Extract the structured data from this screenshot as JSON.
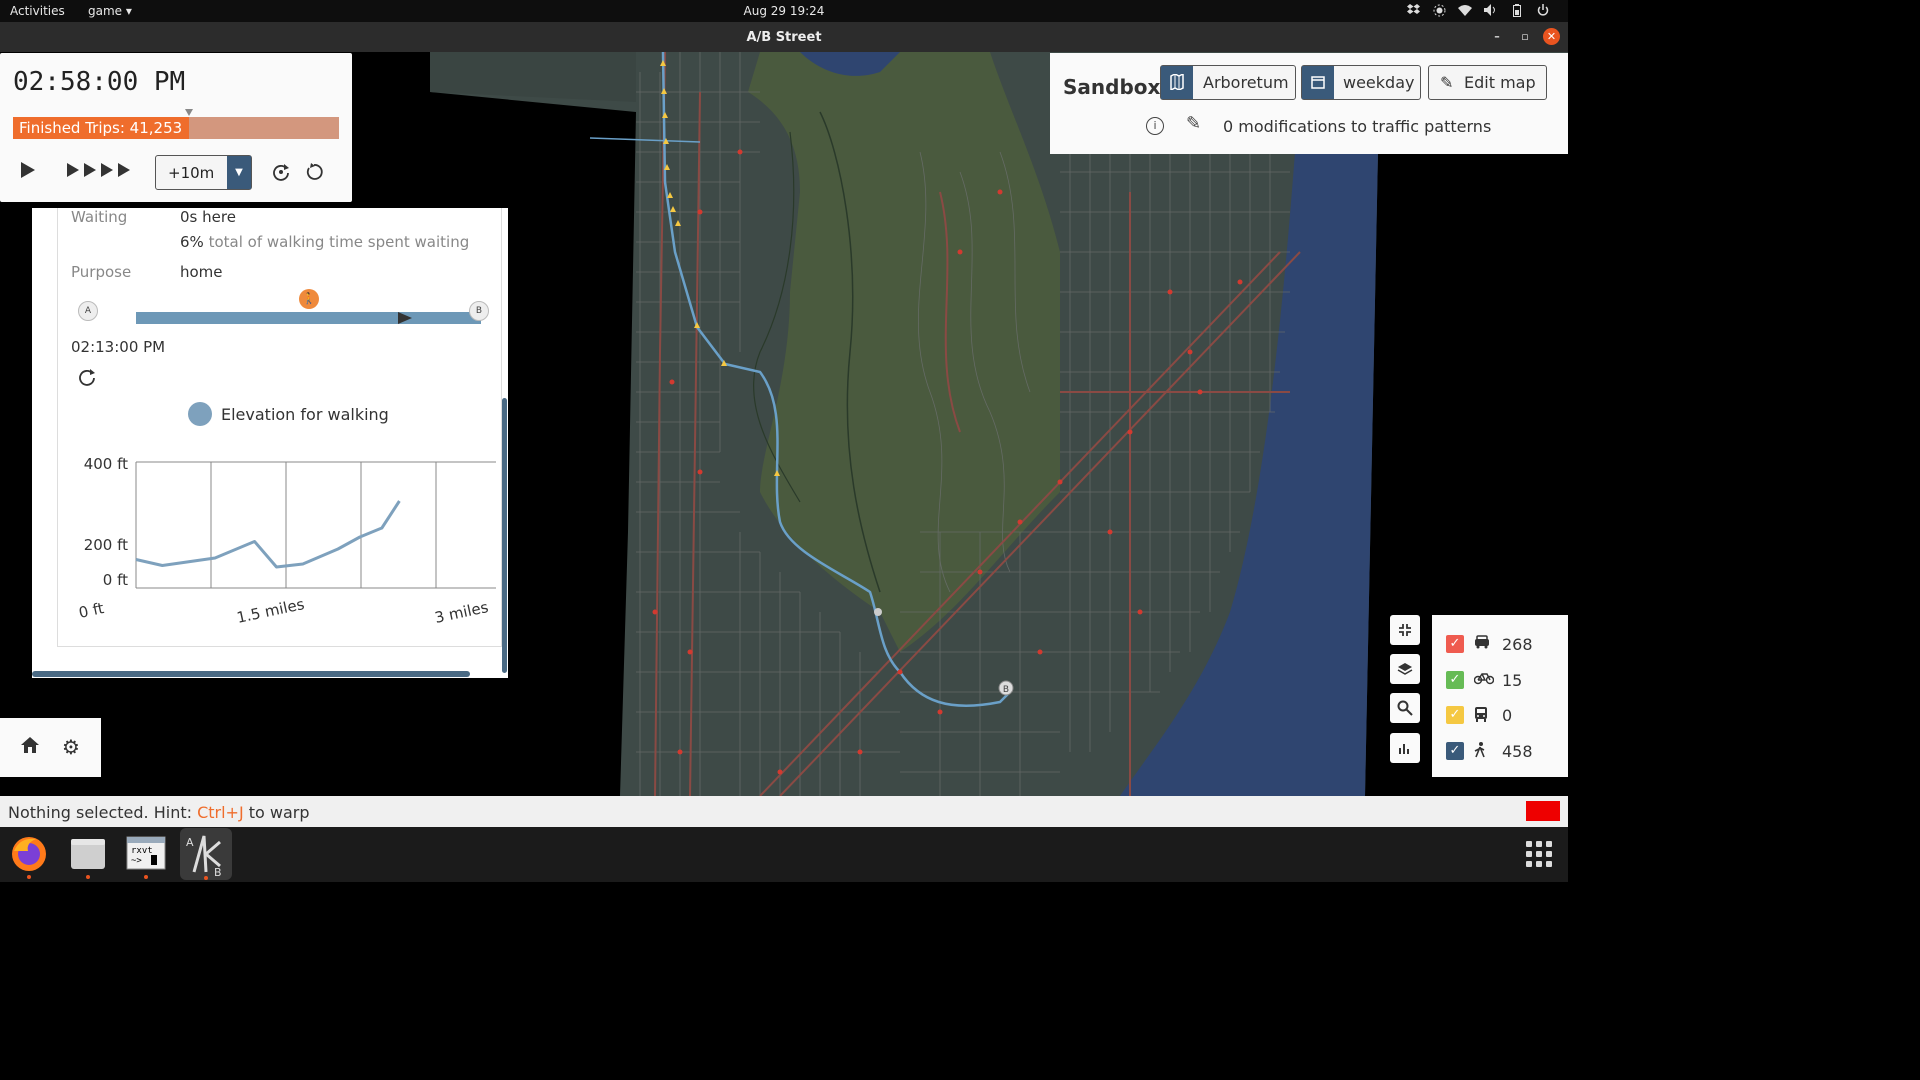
{
  "topbar": {
    "activities": "Activities",
    "app_menu": "game ▾",
    "clock": "Aug 29  19:24"
  },
  "window": {
    "title": "A/B Street"
  },
  "time_panel": {
    "time": "02:58:00 PM",
    "finished_trips": "Finished Trips: 41,253",
    "finished_trips_fraction": 0.54,
    "play_icon": "play-icon",
    "fast_forward_icon": "fast-forward-icon",
    "jump_value": "+10m"
  },
  "trip_info": {
    "waiting_key": "Waiting",
    "waiting_value": "0s here",
    "waiting_pct": "6%",
    "waiting_pct_text": "total of walking time spent waiting",
    "purpose_key": "Purpose",
    "purpose_value": "home",
    "start_label": "A",
    "end_label": "B",
    "trip_progress": 0.8,
    "start_time": "02:13:00 PM",
    "chart_legend": "Elevation for walking"
  },
  "chart_data": {
    "type": "line",
    "title": "",
    "xlabel": "",
    "ylabel": "",
    "series": [
      {
        "name": "Elevation for walking",
        "x": [
          0,
          0.3,
          0.9,
          1.35,
          1.6,
          1.9,
          2.3,
          2.55,
          2.8,
          3.0
        ],
        "values": [
          95,
          75,
          100,
          155,
          70,
          80,
          130,
          170,
          200,
          290
        ]
      }
    ],
    "x_range": [
      0,
      4.1
    ],
    "y_range": [
      0,
      420
    ],
    "x_tick_labels": [
      "0 ft",
      "1.5 miles",
      "3 miles"
    ],
    "y_tick_labels": [
      "400 ft",
      "200 ft",
      "0 ft"
    ],
    "x_gridline_count": 5,
    "grid": true
  },
  "sandbox": {
    "title": "Sandbox",
    "map_name": "Arboretum",
    "scenario": "weekday",
    "edit_map": "Edit map",
    "modifications": "0 modifications to traffic patterns"
  },
  "agents": [
    {
      "icon": "car-icon",
      "count": "268",
      "color": "#ef5b4f"
    },
    {
      "icon": "bike-icon",
      "count": "15",
      "color": "#66bb55"
    },
    {
      "icon": "bus-icon",
      "count": "0",
      "color": "#f5c842"
    },
    {
      "icon": "pedestrian-icon",
      "count": "458",
      "color": "#3a5a7a"
    }
  ],
  "statusbar": {
    "prefix": "Nothing selected. Hint: ",
    "shortcut": "Ctrl+J",
    "suffix": " to warp"
  },
  "dock": [
    {
      "name": "firefox"
    },
    {
      "name": "files"
    },
    {
      "name": "terminal",
      "label": "rxvt"
    },
    {
      "name": "abstreet",
      "label": "A/B"
    }
  ]
}
